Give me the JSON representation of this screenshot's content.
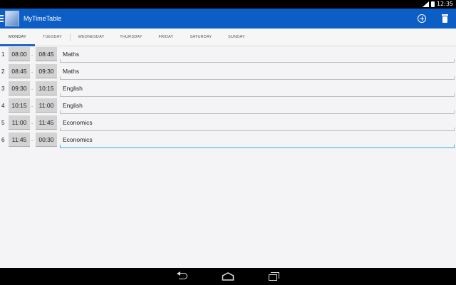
{
  "status_bar": {
    "time": "12:35"
  },
  "app": {
    "title": "MyTimeTable"
  },
  "tabs": [
    {
      "label": "MONDAY"
    },
    {
      "label": "TUESDAY"
    },
    {
      "label": "WEDNESDAY"
    },
    {
      "label": "THURSDAY"
    },
    {
      "label": "FRIDAY"
    },
    {
      "label": "SATURDAY"
    },
    {
      "label": "SUNDAY"
    }
  ],
  "active_tab": "MONDAY",
  "lessons": [
    {
      "num": "1",
      "start": "08:00",
      "end": "08:45",
      "subject": "Maths"
    },
    {
      "num": "2",
      "start": "08:45",
      "end": "09:30",
      "subject": "Maths"
    },
    {
      "num": "3",
      "start": "09:30",
      "end": "10:15",
      "subject": "English"
    },
    {
      "num": "4",
      "start": "10:15",
      "end": "11:00",
      "subject": "English"
    },
    {
      "num": "5",
      "start": "11:00",
      "end": "11:45",
      "subject": "Economics"
    },
    {
      "num": "6",
      "start": "11:45",
      "end": "00:30",
      "subject": "Economics"
    }
  ],
  "time_separator": "-",
  "icons": {
    "menu": "hamburger-icon",
    "app": "app-icon",
    "add": "add-circle-icon",
    "delete": "trash-icon",
    "back": "back-icon",
    "home": "home-icon",
    "recents": "recents-icon"
  },
  "colors": {
    "action_bar": "#0c5ec6",
    "tab_indicator": "#1f64c4",
    "focus_underline": "#33b5e5",
    "background": "#f4f4f6"
  }
}
